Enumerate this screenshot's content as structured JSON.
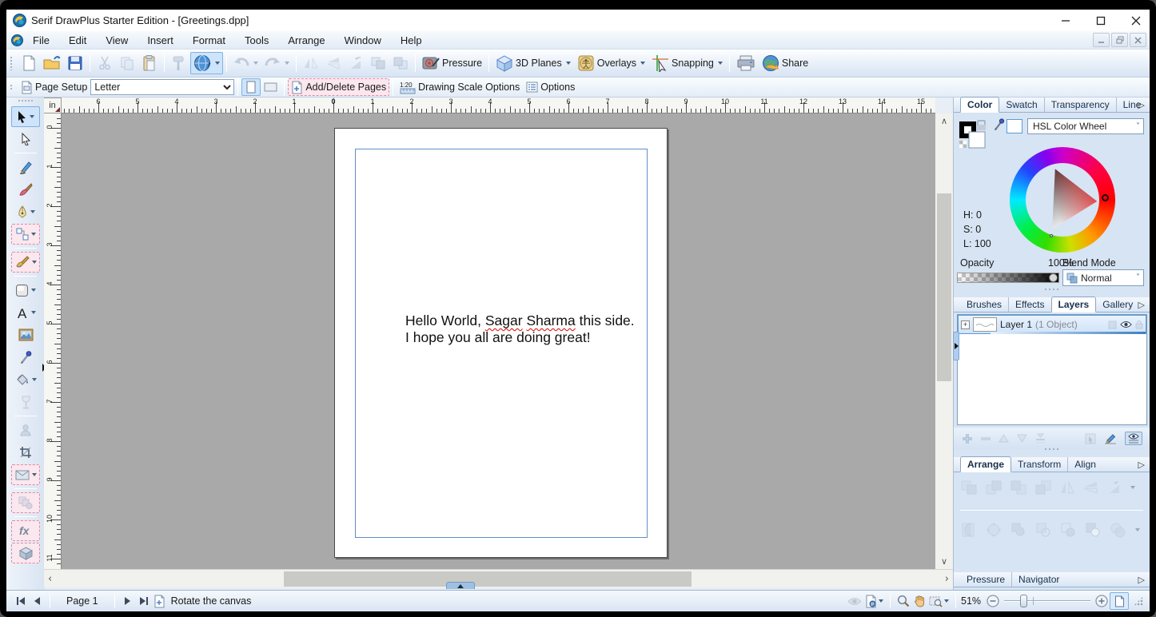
{
  "colors": {
    "selection_blue": "#cde4fa",
    "accent_border": "#7fb2e5",
    "locked_pink_bg": "#fbe7ee",
    "locked_pink_border": "#e08aa4",
    "squiggle_red": "#e00000",
    "canvas_gray": "#a9a9a9",
    "margin_blue": "#5f8fc7"
  },
  "window": {
    "title": "Serif DrawPlus Starter Edition - [Greetings.dpp]"
  },
  "menubar": {
    "items": [
      "File",
      "Edit",
      "View",
      "Insert",
      "Format",
      "Tools",
      "Arrange",
      "Window",
      "Help"
    ]
  },
  "toolbar": {
    "pressure_label": "Pressure",
    "planes_label": "3D Planes",
    "overlays_label": "Overlays",
    "snapping_label": "Snapping",
    "share_label": "Share"
  },
  "context_toolbar": {
    "page_setup_label": "Page Setup",
    "paper_size": "Letter",
    "add_delete_pages_label": "Add/Delete Pages",
    "scale_badge": "1:20",
    "drawing_scale_label": "Drawing Scale Options",
    "options_label": "Options"
  },
  "rulers": {
    "unit": "in",
    "h_labels": [
      6,
      5,
      4,
      3,
      2,
      1,
      0,
      1,
      2,
      3,
      4,
      5,
      6,
      7,
      8,
      9,
      10,
      11,
      12,
      13,
      14,
      15
    ],
    "v_labels": [
      0,
      1,
      2,
      3,
      4,
      5,
      6,
      7,
      8,
      9,
      10,
      11
    ]
  },
  "document": {
    "line1_prefix": "Hello World, ",
    "word1": "Sagar",
    "space": " ",
    "word2": "Sharma",
    "line1_suffix": " this side.",
    "line2": "I hope you all are doing great!"
  },
  "color_panel": {
    "tabs": [
      "Color",
      "Swatch",
      "Transparency",
      "Line"
    ],
    "active_tab": "Color",
    "mode_dropdown": "HSL Color Wheel",
    "h": "H: 0",
    "s": "S: 0",
    "l": "L: 100",
    "opacity_label": "Opacity",
    "opacity_value": "100%",
    "blend_label": "Blend Mode",
    "blend_value": "Normal"
  },
  "studio_panel": {
    "tabs": [
      "Brushes",
      "Effects",
      "Layers",
      "Gallery"
    ],
    "active_tab": "Layers",
    "layer_name": "Layer 1",
    "layer_count": "(1 Object)"
  },
  "arrange_panel": {
    "tabs": [
      "Arrange",
      "Transform",
      "Align"
    ],
    "active_tab": "Arrange"
  },
  "bottom_panel": {
    "tabs": [
      "Pressure",
      "Navigator"
    ]
  },
  "statusbar": {
    "page": "Page 1",
    "hint": "Rotate the canvas",
    "zoom": "51%"
  }
}
